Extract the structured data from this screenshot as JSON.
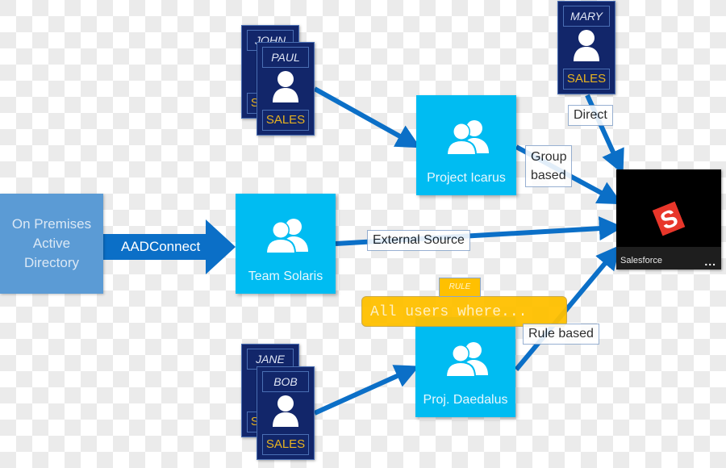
{
  "source": {
    "label": "On Premises\nActive\nDirectory"
  },
  "connector": {
    "label": "AADConnect"
  },
  "groups": [
    {
      "id": "team-solaris",
      "label": "Team Solaris"
    },
    {
      "id": "project-icarus",
      "label": "Project Icarus"
    },
    {
      "id": "proj-daedalus",
      "label": "Proj. Daedalus"
    }
  ],
  "users": [
    {
      "name": "JOHN",
      "dept": "SALES"
    },
    {
      "name": "PAUL",
      "dept": "SALES"
    },
    {
      "name": "MARY",
      "dept": "SALES"
    },
    {
      "name": "JANE",
      "dept": "SALES"
    },
    {
      "name": "BOB",
      "dept": "SALES"
    }
  ],
  "edge_labels": {
    "direct": "Direct",
    "group_based": "Group\nbased",
    "external_source": "External Source",
    "rule_based": "Rule based"
  },
  "rule": {
    "tag": "RULE",
    "expression": "All users where..."
  },
  "app": {
    "name": "Salesforce",
    "more": "...",
    "logo_letter": "S"
  },
  "colors": {
    "arrow": "#0b6fc7",
    "onprem": "#5b9bd5",
    "group_tile": "#00bcf2",
    "user_card": "#12266a",
    "dept_text": "#e8b320",
    "rule": "#ffc000",
    "salesforce_logo": "#e8362a"
  }
}
